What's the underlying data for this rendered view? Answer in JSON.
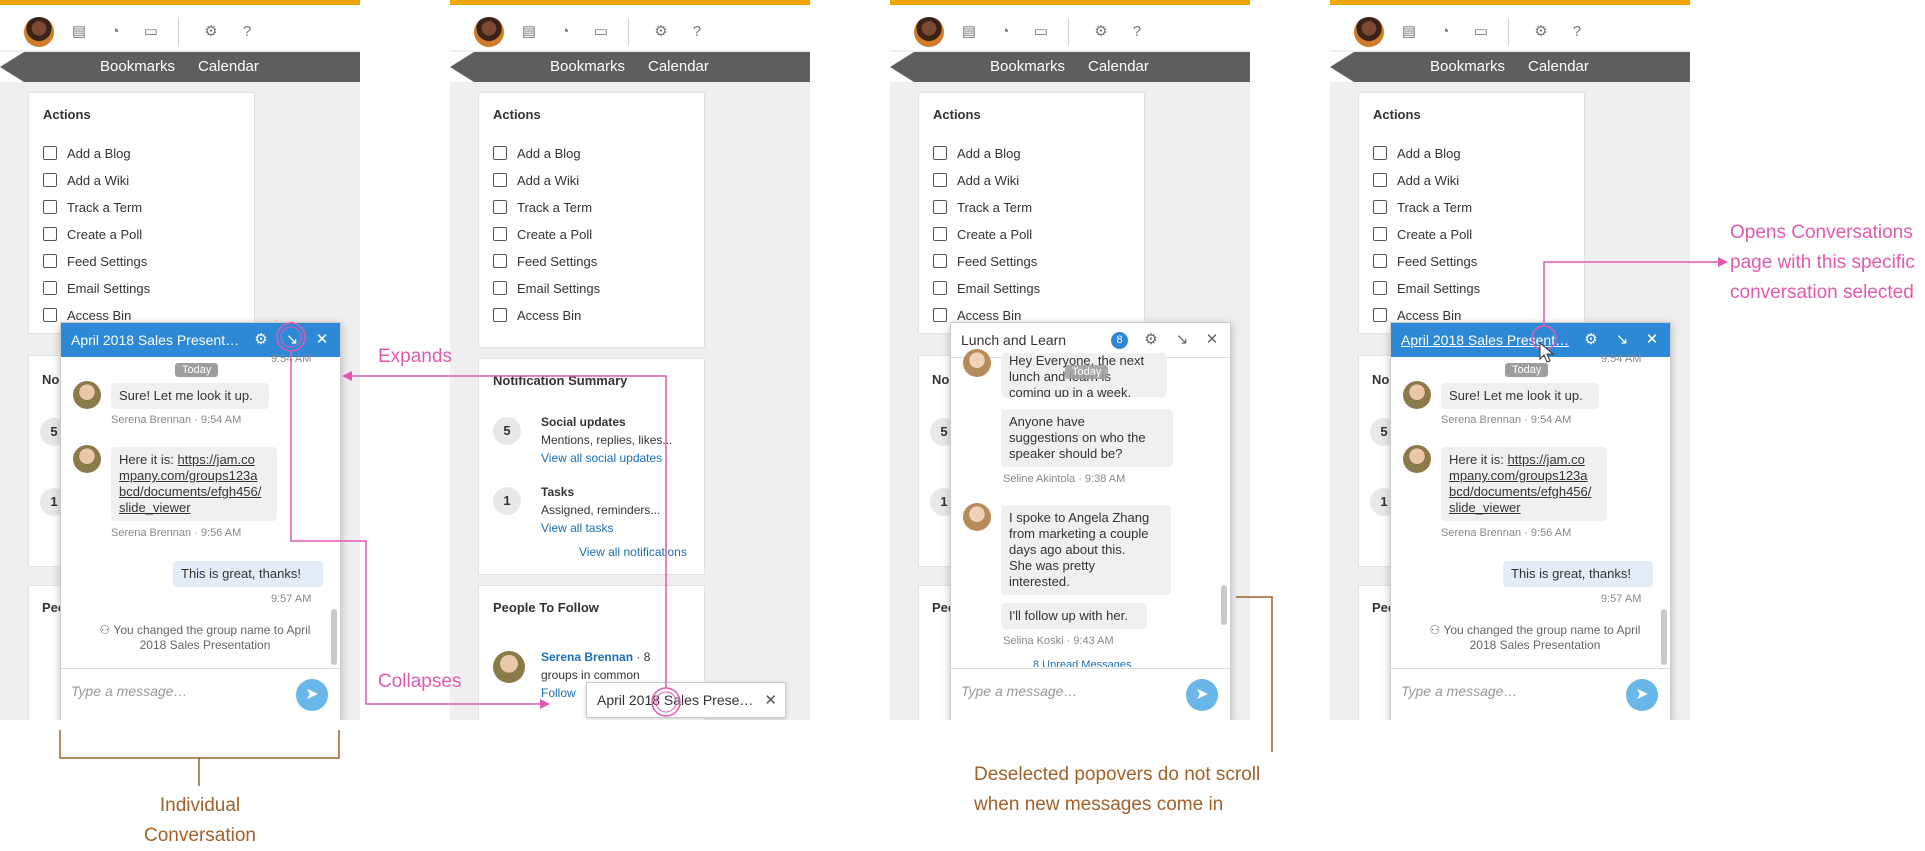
{
  "topbar": {
    "icons": [
      "clipboard-icon",
      "bell-icon",
      "chat-icon",
      "gear-icon",
      "help-icon"
    ]
  },
  "nav": {
    "bookmarks": "Bookmarks",
    "calendar": "Calendar"
  },
  "actions": {
    "title": "Actions",
    "items": [
      "Add a Blog",
      "Add a Wiki",
      "Track a Term",
      "Create a Poll",
      "Feed Settings",
      "Email Settings",
      "Access Bin"
    ]
  },
  "notifications": {
    "title": "Notification Summary",
    "social": {
      "count": "5",
      "title": "Social updates",
      "desc": "Mentions, replies, likes...",
      "link": "View all social updates"
    },
    "tasks": {
      "count": "1",
      "title": "Tasks",
      "desc": "Assigned, reminders...",
      "link": "View all tasks"
    },
    "all_link": "View all notifications",
    "stub": "No"
  },
  "people": {
    "title": "People To Follow",
    "name": "Serena Brennan",
    "groups_suffix": "· 8",
    "groups_line": "groups in common",
    "follow": "Follow",
    "stub": "Peo"
  },
  "conversation": {
    "title": "April 2018 Sales Present…",
    "today": "Today",
    "time_top": "9:54 AM",
    "msg1": "Sure! Let me look it up.",
    "meta1": "Serena Brennan · 9:54 AM",
    "msg2_prefix": "Here it is:",
    "msg2_link_lines": [
      "https://jam.co",
      "mpany.com/groups123a",
      "bcd/documents/efgh456/",
      "slide_viewer"
    ],
    "meta2": "Serena Brennan · 9:56 AM",
    "msg3": "This is great, thanks!",
    "meta3": "9:57 AM",
    "system_lines": [
      "You changed the group name to April",
      "2018 Sales Presentation"
    ],
    "placeholder": "Type a message…"
  },
  "collapsed_tab": {
    "title": "April 2018 Sales Prese…"
  },
  "lunch": {
    "title": "Lunch and Learn",
    "badge": "8",
    "msg1_lines": [
      "Hey Everyone, the next",
      "lunch and learn is",
      "coming up in a week."
    ],
    "msg2_lines": [
      "Anyone have",
      "suggestions on who the",
      "speaker should be?"
    ],
    "meta2": "Seline Akintola · 9:38 AM",
    "msg3_lines": [
      "I spoke to Angela Zhang",
      "from marketing a couple",
      "days ago about this.",
      "She was pretty",
      "interested."
    ],
    "msg4": "I'll follow up with her.",
    "meta4": "Selina Koski · 9:43 AM",
    "unread": "8 Unread Messages",
    "today": "Today",
    "placeholder": "Type a message…"
  },
  "annotations": {
    "expands": "Expands",
    "collapses": "Collapses",
    "individual": [
      "Individual",
      "Conversation"
    ],
    "deselected": [
      "Deselected popovers do not scroll",
      "when new messages come in"
    ],
    "opens": [
      "Opens Conversations",
      "page with this specific",
      "conversation selected"
    ]
  },
  "colors": {
    "accent": "#f0a500",
    "brand_blue": "#2d89d6",
    "annotation_pink": "#e05ab0",
    "annotation_brown": "#a0612a"
  }
}
